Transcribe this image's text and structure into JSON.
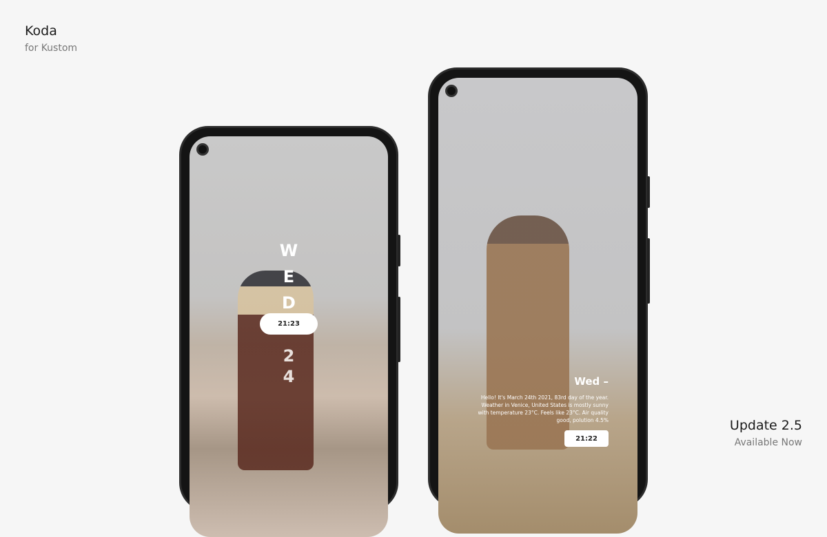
{
  "brand": {
    "title": "Koda",
    "subtitle": "for Kustom"
  },
  "update": {
    "title": "Update 2.5",
    "subtitle": "Available Now"
  },
  "phone_left": {
    "day_letters": [
      "W",
      "E",
      "D"
    ],
    "time": "21:23",
    "date_digits": [
      "2",
      "4"
    ]
  },
  "phone_right": {
    "day": "Wed –",
    "info": "Hello! It's March 24th 2021, 83rd day of the year. Weather in Venice, United States is mostly sunny with temperature 23°C. Feels like 23°C. Air quality good, polution 4.5%",
    "time": "21:22"
  }
}
